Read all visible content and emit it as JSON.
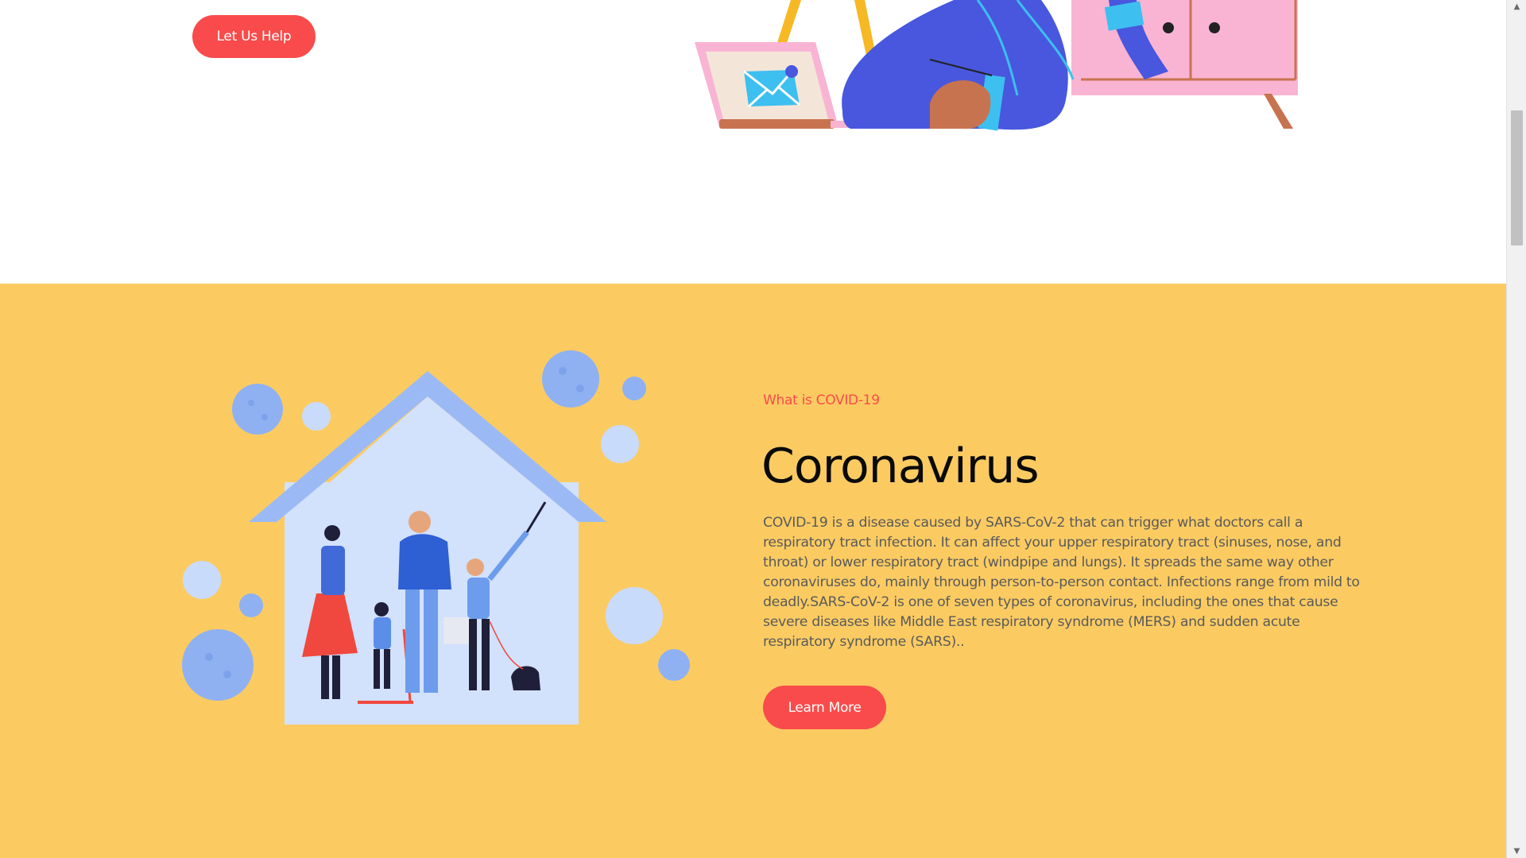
{
  "top": {
    "help_button": "Let Us Help"
  },
  "covid": {
    "eyebrow": "What is COVID-19",
    "heading": "Coronavirus",
    "body": "COVID-19 is a disease caused by SARS-CoV-2 that can trigger what doctors call a respiratory tract infection. It can affect your upper respiratory tract (sinuses, nose, and throat) or lower respiratory tract (windpipe and lungs). It spreads the same way other coronaviruses do, mainly through person-to-person contact. Infections range from mild to deadly.SARS-CoV-2 is one of seven types of coronavirus, including the ones that cause severe diseases like Middle East respiratory syndrome (MERS) and sudden acute respiratory syndrome (SARS)..",
    "learn_more_button": "Learn More"
  },
  "colors": {
    "accent": "#f94b4b",
    "section_bg": "#fbcb62"
  },
  "scrollbar": {
    "up_arrow": "▲",
    "down_arrow": "▼"
  }
}
